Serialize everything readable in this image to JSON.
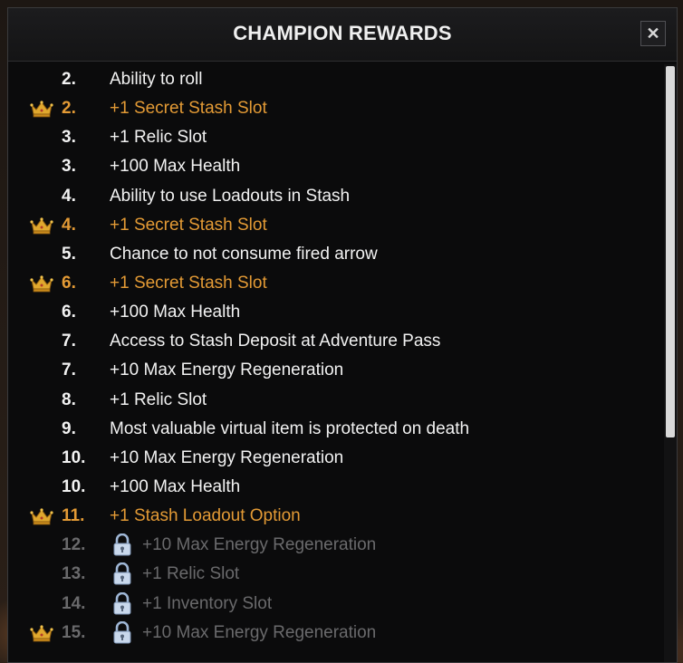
{
  "window": {
    "title": "CHAMPION REWARDS",
    "close_label": "✕"
  },
  "colors": {
    "gold": "#e39a35",
    "white": "#f2f2f2",
    "locked": "#6a6a6c",
    "panel": "#0b0b0c"
  },
  "rewards": [
    {
      "num": "2.",
      "text": "Ability to roll",
      "champion": false,
      "locked": false
    },
    {
      "num": "2.",
      "text": "+1 Secret Stash Slot",
      "champion": true,
      "locked": false
    },
    {
      "num": "3.",
      "text": "+1 Relic Slot",
      "champion": false,
      "locked": false
    },
    {
      "num": "3.",
      "text": "+100 Max Health",
      "champion": false,
      "locked": false
    },
    {
      "num": "4.",
      "text": "Ability to use Loadouts in Stash",
      "champion": false,
      "locked": false
    },
    {
      "num": "4.",
      "text": "+1 Secret Stash Slot",
      "champion": true,
      "locked": false
    },
    {
      "num": "5.",
      "text": "Chance to not consume fired arrow",
      "champion": false,
      "locked": false
    },
    {
      "num": "6.",
      "text": "+1 Secret Stash Slot",
      "champion": true,
      "locked": false
    },
    {
      "num": "6.",
      "text": "+100 Max Health",
      "champion": false,
      "locked": false
    },
    {
      "num": "7.",
      "text": "Access to Stash Deposit at Adventure Pass",
      "champion": false,
      "locked": false
    },
    {
      "num": "7.",
      "text": "+10 Max Energy Regeneration",
      "champion": false,
      "locked": false
    },
    {
      "num": "8.",
      "text": "+1 Relic Slot",
      "champion": false,
      "locked": false
    },
    {
      "num": "9.",
      "text": "Most valuable virtual item is protected on death",
      "champion": false,
      "locked": false
    },
    {
      "num": "10.",
      "text": "+10 Max Energy Regeneration",
      "champion": false,
      "locked": false
    },
    {
      "num": "10.",
      "text": "+100 Max Health",
      "champion": false,
      "locked": false
    },
    {
      "num": "11.",
      "text": "+1 Stash Loadout Option",
      "champion": true,
      "locked": false
    },
    {
      "num": "12.",
      "text": "+10 Max Energy Regeneration",
      "champion": false,
      "locked": true
    },
    {
      "num": "13.",
      "text": "+1 Relic Slot",
      "champion": false,
      "locked": true
    },
    {
      "num": "14.",
      "text": "+1 Inventory Slot",
      "champion": false,
      "locked": true
    },
    {
      "num": "15.",
      "text": "+10 Max Energy Regeneration",
      "champion": true,
      "locked": true
    }
  ]
}
